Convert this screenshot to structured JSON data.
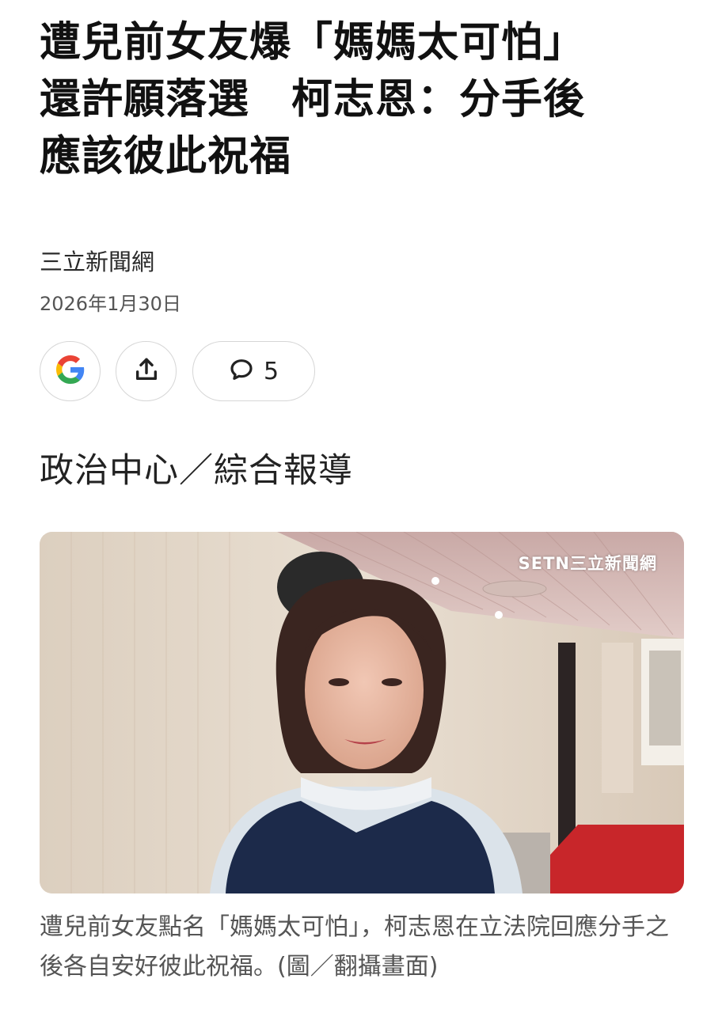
{
  "article": {
    "headline": "遭兒前女友爆「媽媽太可怕」\n還許願落選　柯志恩：分手後\n應該彼此祝福",
    "source": "三立新聞網",
    "date": "2026年1月30日",
    "section_label": "政治中心／綜合報導"
  },
  "actions": {
    "google_icon": "google-icon",
    "share_icon": "share-icon",
    "comment_icon": "comment-icon",
    "comment_count": "5"
  },
  "photo": {
    "watermark": "SETN三立新聞網"
  },
  "caption": "遭兒前女友點名「媽媽太可怕」，柯志恩在立法院回應分手之後各自安好彼此祝福。(圖／翻攝畫面)",
  "colors": {
    "google_blue": "#4285F4",
    "google_red": "#EA4335",
    "google_yellow": "#FBBC05",
    "google_green": "#34A853",
    "pill_border": "#d6d6d6"
  }
}
